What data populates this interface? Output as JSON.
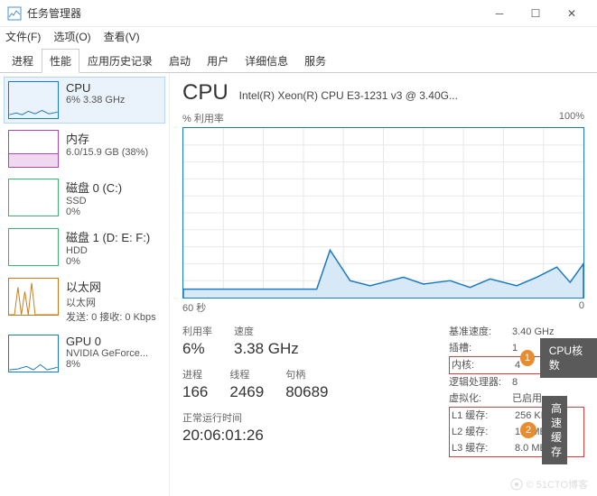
{
  "window": {
    "title": "任务管理器"
  },
  "menu": {
    "file": "文件(F)",
    "options": "选项(O)",
    "view": "查看(V)"
  },
  "tabs": [
    "进程",
    "性能",
    "应用历史记录",
    "启动",
    "用户",
    "详细信息",
    "服务"
  ],
  "active_tab": 1,
  "sidebar": {
    "items": [
      {
        "title": "CPU",
        "sub": "6% 3.38 GHz",
        "color": "#1a7bc4"
      },
      {
        "title": "内存",
        "sub": "6.0/15.9 GB (38%)",
        "color": "#a64ca6"
      },
      {
        "title": "磁盘 0 (C:)",
        "sub": "SSD",
        "sub2": "0%",
        "color": "#3cb371"
      },
      {
        "title": "磁盘 1 (D: E: F:)",
        "sub": "HDD",
        "sub2": "0%",
        "color": "#3cb371"
      },
      {
        "title": "以太网",
        "sub": "以太网",
        "sub2": "发送: 0 接收: 0 Kbps",
        "color": "#c47a1a"
      },
      {
        "title": "GPU 0",
        "sub": "NVIDIA GeForce...",
        "sub2": "8%",
        "color": "#1a7bc4"
      }
    ]
  },
  "main": {
    "title": "CPU",
    "model": "Intel(R) Xeon(R) CPU E3-1231 v3 @ 3.40G...",
    "chart_top_left": "% 利用率",
    "chart_top_right": "100%",
    "chart_bottom_left": "60 秒",
    "chart_bottom_right": "0",
    "stats1": [
      {
        "label": "利用率",
        "value": "6%"
      },
      {
        "label": "速度",
        "value": "3.38 GHz"
      }
    ],
    "stats2": [
      {
        "label": "进程",
        "value": "166"
      },
      {
        "label": "线程",
        "value": "2469"
      },
      {
        "label": "句柄",
        "value": "80689"
      }
    ],
    "uptime_label": "正常运行时间",
    "uptime_value": "20:06:01:26",
    "right_table": [
      {
        "k": "基准速度:",
        "v": "3.40 GHz"
      },
      {
        "k": "插槽:",
        "v": "1"
      },
      {
        "k": "内核:",
        "v": "4",
        "boxed": true
      },
      {
        "k": "逻辑处理器:",
        "v": "8"
      },
      {
        "k": "虚拟化:",
        "v": "已启用"
      },
      {
        "k": "L1 缓存:",
        "v": "256 KB",
        "cache": true
      },
      {
        "k": "L2 缓存:",
        "v": "1.0 MB",
        "cache": true
      },
      {
        "k": "L3 缓存:",
        "v": "8.0 MB",
        "cache": true
      }
    ]
  },
  "callouts": {
    "c1": {
      "num": "1",
      "text": "CPU核数",
      "color": "#e88c30"
    },
    "c2": {
      "num": "2",
      "text": "高速缓存",
      "color": "#e88c30"
    }
  },
  "watermark": "© 51CTO博客",
  "chart_data": {
    "type": "line",
    "title": "% 利用率",
    "xlabel": "60 秒",
    "ylabel": "",
    "ylim": [
      0,
      100
    ],
    "x": [
      0,
      5,
      10,
      15,
      20,
      22,
      25,
      28,
      30,
      33,
      36,
      40,
      43,
      46,
      50,
      53,
      56,
      58,
      60
    ],
    "values": [
      5,
      5,
      5,
      5,
      5,
      28,
      10,
      7,
      9,
      12,
      8,
      10,
      6,
      11,
      7,
      12,
      18,
      9,
      20
    ]
  }
}
